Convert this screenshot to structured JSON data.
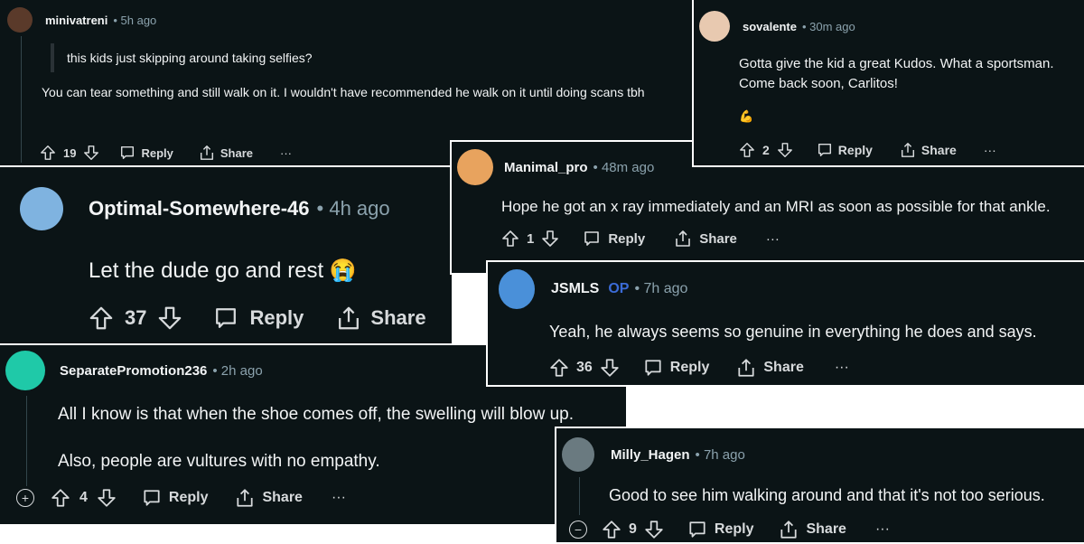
{
  "comments": [
    {
      "user": "minivatreni",
      "time": "• 5h ago",
      "quote": "this kids just skipping around taking selfies?",
      "text": "You can tear something and still walk on it. I wouldn't have recommended he walk on it until doing scans tbh",
      "score": "19",
      "reply": "Reply",
      "share": "Share",
      "more": "···",
      "avatar_color": "#5a3a2a"
    },
    {
      "user": "sovalente",
      "time": "• 30m ago",
      "text": "Gotta give the kid a great Kudos. What a sportsman. Come back soon, Carlitos!",
      "emoji": "💪",
      "score": "2",
      "reply": "Reply",
      "share": "Share",
      "more": "···",
      "avatar_color": "#e8c9b0"
    },
    {
      "user": "Optimal-Somewhere-46",
      "time": "• 4h ago",
      "text": "Let the dude go and rest 😭",
      "score": "37",
      "reply": "Reply",
      "share": "Share",
      "avatar_color": "#7fb3e0"
    },
    {
      "user": "Manimal_pro",
      "time": "• 48m ago",
      "text": "Hope he got an x ray immediately and an MRI as soon as possible for that ankle.",
      "score": "1",
      "reply": "Reply",
      "share": "Share",
      "more": "···",
      "avatar_color": "#e8a35e"
    },
    {
      "user": "JSMLS",
      "op": "OP",
      "time": "• 7h ago",
      "text": "Yeah, he always seems so genuine in everything he does and says.",
      "score": "36",
      "reply": "Reply",
      "share": "Share",
      "more": "···",
      "avatar_color": "#4a90d9"
    },
    {
      "user": "SeparatePromotion236",
      "time": "• 2h ago",
      "text": "All I know is that when the shoe comes off, the swelling will blow up.",
      "text2": "Also, people are vultures with no empathy.",
      "score": "4",
      "reply": "Reply",
      "share": "Share",
      "more": "···",
      "avatar_color": "#1fc9a8"
    },
    {
      "user": "Milly_Hagen",
      "time": "• 7h ago",
      "text": "Good to see him walking around and that it's not too serious.",
      "score": "9",
      "reply": "Reply",
      "share": "Share",
      "more": "···",
      "avatar_color": "#6a7a80"
    }
  ]
}
